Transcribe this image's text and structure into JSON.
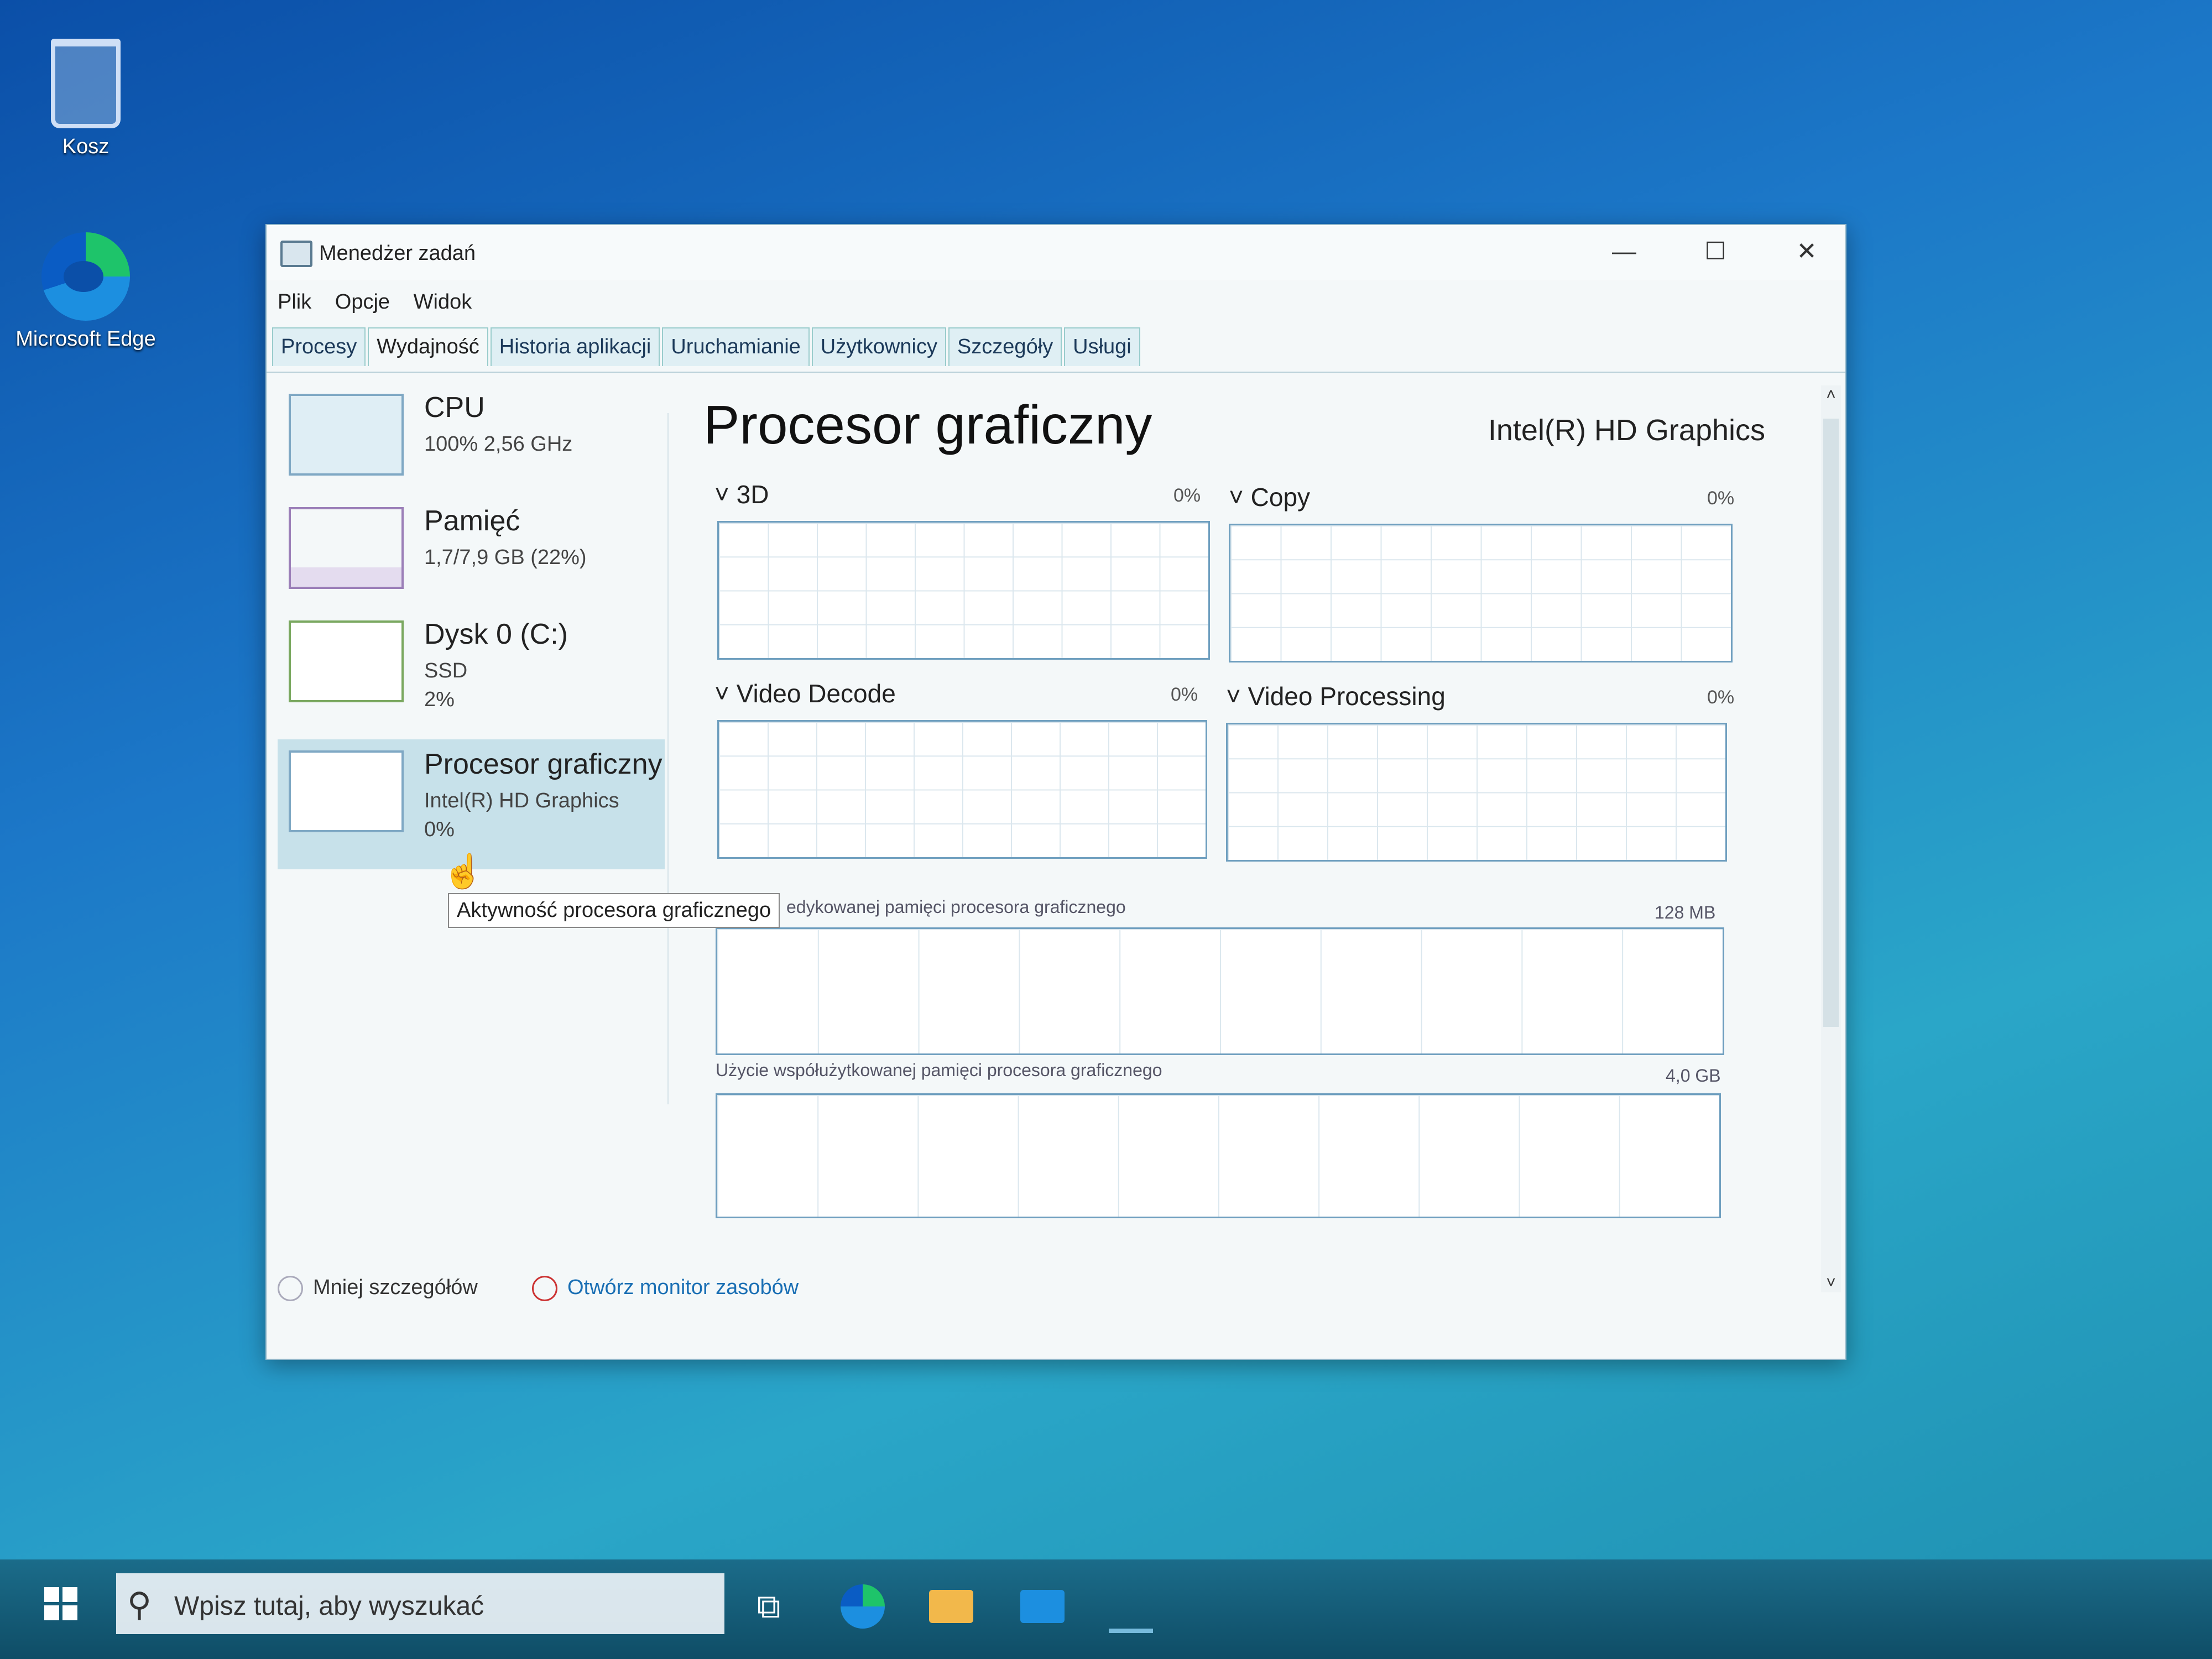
{
  "desktop": {
    "icons": [
      {
        "label": "Kosz"
      },
      {
        "label": "Microsoft Edge"
      }
    ]
  },
  "window": {
    "title": "Menedżer zadań",
    "controls": {
      "minimize": "—",
      "maximize": "☐",
      "close": "✕"
    }
  },
  "menu": [
    "Plik",
    "Opcje",
    "Widok"
  ],
  "tabs": [
    "Procesy",
    "Wydajność",
    "Historia aplikacji",
    "Uruchamianie",
    "Użytkownicy",
    "Szczegóły",
    "Usługi"
  ],
  "active_tab": "Wydajność",
  "left_panel": [
    {
      "name": "CPU",
      "line1": "100% 2,56 GHz",
      "line2": ""
    },
    {
      "name": "Pamięć",
      "line1": "1,7/7,9 GB (22%)",
      "line2": ""
    },
    {
      "name": "Dysk 0 (C:)",
      "line1": "SSD",
      "line2": "2%"
    },
    {
      "name": "Procesor graficzny",
      "line1": "Intel(R) HD Graphics",
      "line2": "0%",
      "selected": true
    }
  ],
  "main": {
    "title": "Procesor graficzny",
    "device": "Intel(R) HD Graphics",
    "engines": [
      {
        "label": "3D",
        "value": "0%"
      },
      {
        "label": "Copy",
        "value": "0%"
      },
      {
        "label": "Video Decode",
        "value": "0%"
      },
      {
        "label": "Video Processing",
        "value": "0%"
      }
    ],
    "dedicated_memory": {
      "label": "edykowanej pamięci procesora graficznego",
      "value": "128 MB"
    },
    "shared_memory": {
      "label": "Użycie współużytkowanej pamięci procesora graficznego",
      "value": "4,0 GB"
    }
  },
  "tooltip": "Aktywność procesora graficznego",
  "footer": {
    "fewer_details": "Mniej szczegółów",
    "open_monitor": "Otwórz monitor zasobów"
  },
  "taskbar": {
    "search_placeholder": "Wpisz tutaj, aby wyszukać"
  },
  "colors": {
    "accent": "#1a6fb4",
    "graph_border": "#6f9fbf",
    "selected_bg": "#c7e1ea"
  }
}
